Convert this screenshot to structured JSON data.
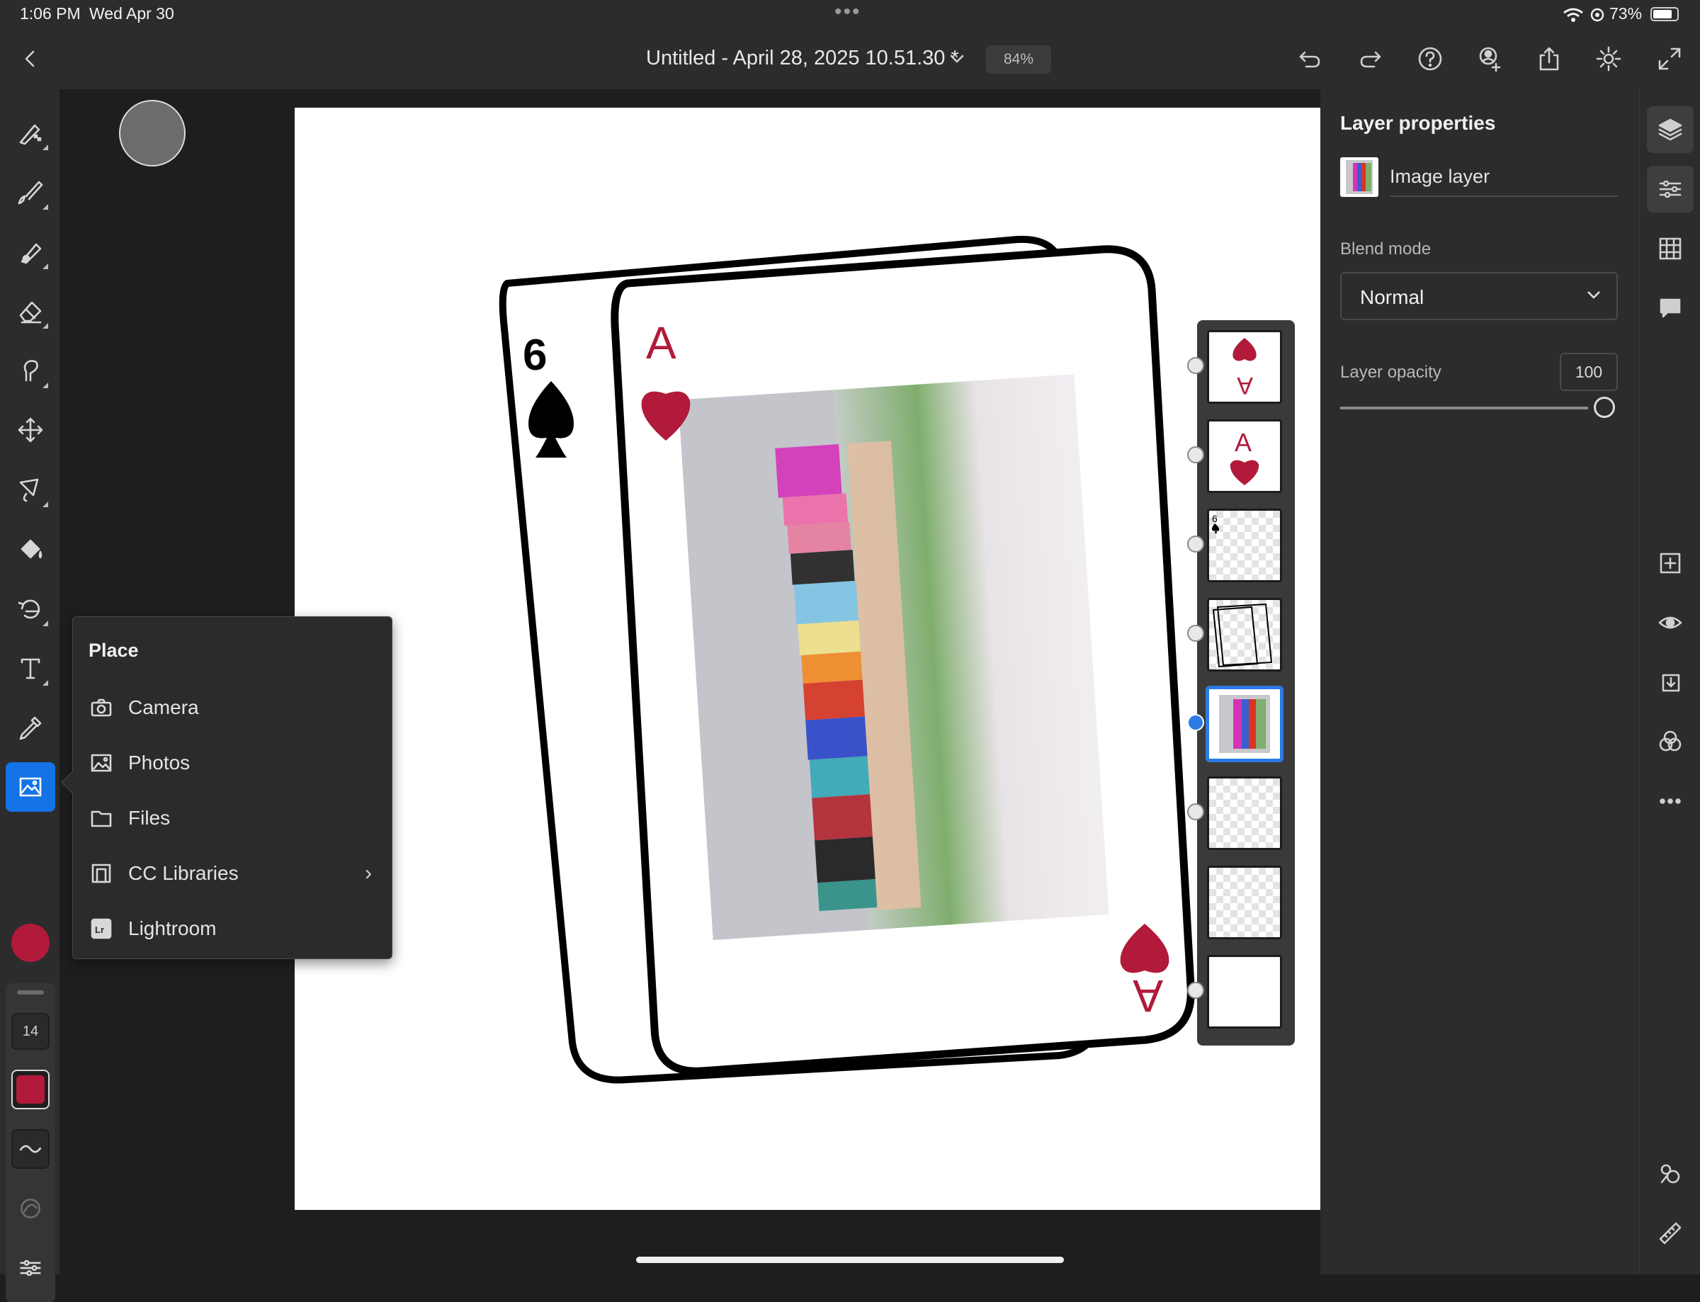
{
  "status_bar": {
    "time": "1:06 PM",
    "date": "Wed Apr 30",
    "battery": "73%",
    "dots": "•••"
  },
  "toolbar": {
    "doc_title": "Untitled - April 28, 2025 10.51.30 *",
    "zoom": "84%",
    "icons": [
      "back-icon",
      "chevron-down-icon",
      "undo-icon",
      "redo-icon",
      "help-icon",
      "invite-icon",
      "share-icon",
      "settings-icon",
      "fullscreen-icon"
    ]
  },
  "tools": {
    "items": [
      "pixel-brush-icon",
      "paint-brush-icon",
      "live-brush-icon",
      "eraser-icon",
      "smudge-icon",
      "move-icon",
      "lasso-icon",
      "fill-icon",
      "transform-icon",
      "type-icon",
      "eyedropper-icon",
      "place-image-icon"
    ],
    "active": "place-image-icon",
    "size_value": "14",
    "color": "#b11a3a"
  },
  "place_menu": {
    "title": "Place",
    "items": [
      {
        "label": "Camera",
        "icon": "camera-icon"
      },
      {
        "label": "Photos",
        "icon": "photos-icon"
      },
      {
        "label": "Files",
        "icon": "folder-icon"
      },
      {
        "label": "CC Libraries",
        "icon": "libraries-icon"
      },
      {
        "label": "Lightroom",
        "icon": "lightroom-icon"
      }
    ]
  },
  "canvas": {
    "back_card": {
      "rank": "6",
      "suit": "spade"
    },
    "front_card": {
      "rank": "A",
      "suit": "heart"
    },
    "card_color": "#b11a3a"
  },
  "layers": {
    "selected_index": 4,
    "count": 8
  },
  "layer_properties": {
    "title": "Layer properties",
    "layer_name": "Image layer",
    "blend_mode_label": "Blend mode",
    "blend_mode_value": "Normal",
    "opacity_label": "Layer opacity",
    "opacity_value": "100"
  },
  "right_rail": {
    "icons": [
      "layers-icon",
      "properties-icon",
      "grid-icon",
      "comments-icon",
      "add-layer-icon",
      "visibility-icon",
      "import-icon",
      "blend-icon",
      "more-icon",
      "assets-icon",
      "ruler-icon"
    ]
  }
}
